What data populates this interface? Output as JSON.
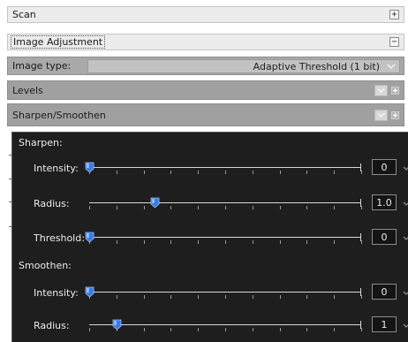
{
  "panels": {
    "scan": {
      "title": "Scan",
      "toggle": "+"
    },
    "image_adjustment": {
      "title": "Image Adjustment",
      "toggle": "−"
    },
    "image_type": {
      "label": "Image type:",
      "value": "Adaptive Threshold (1 bit)"
    },
    "levels": {
      "title": "Levels",
      "toggle": "+"
    },
    "sharpen_smoothen": {
      "title": "Sharpen/Smoothen",
      "toggle": "+"
    }
  },
  "sharpen": {
    "title": "Sharpen:",
    "intensity": {
      "label": "Intensity:",
      "value": "0",
      "level": 0.0
    },
    "radius": {
      "label": "Radius:",
      "value": "1.0",
      "level": 0.24
    },
    "threshold": {
      "label": "Threshold:",
      "value": "0",
      "level": 0.0
    }
  },
  "smoothen": {
    "title": "Smoothen:",
    "intensity": {
      "label": "Intensity:",
      "value": "0",
      "level": 0.0
    },
    "radius": {
      "label": "Radius:",
      "value": "1",
      "level": 0.1
    }
  },
  "colors": {
    "dark_panel": "#1e1e1e",
    "thumb": "#3a7be0",
    "header_grey": "#a0a0a0"
  }
}
